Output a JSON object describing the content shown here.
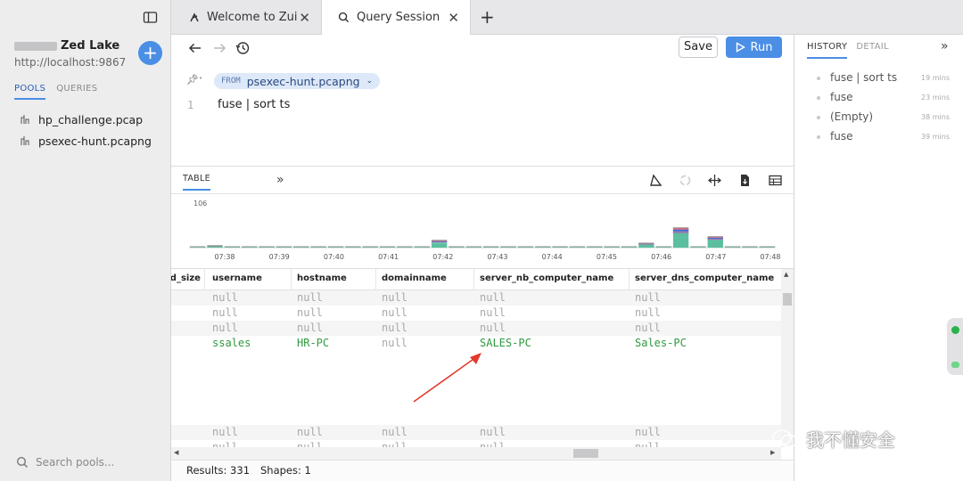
{
  "sidebar": {
    "lake_name": "Zed Lake",
    "lake_url": "http://localhost:9867",
    "add_label": "+",
    "tabs": [
      "POOLS",
      "QUERIES"
    ],
    "pools": [
      "hp_challenge.pcap",
      "psexec-hunt.pcapng"
    ],
    "search_placeholder": "Search pools..."
  },
  "tabs": [
    {
      "label": "Welcome to Zui",
      "icon": "zui-logo-icon"
    },
    {
      "label": "Query Session",
      "icon": "search-icon"
    }
  ],
  "toolbar": {
    "save_label": "Save",
    "run_label": "Run"
  },
  "editor": {
    "from_keyword": "FROM",
    "pool": "psexec-hunt.pcapng",
    "line_number": "1",
    "query": "fuse | sort ts"
  },
  "results": {
    "tab_label": "TABLE",
    "expand": "»",
    "columns": [
      "ed_size",
      "username",
      "hostname",
      "domainname",
      "server_nb_computer_name",
      "server_dns_computer_name"
    ],
    "rows": [
      [
        "",
        "null",
        "null",
        "null",
        "null",
        "null"
      ],
      [
        "",
        "null",
        "null",
        "null",
        "null",
        "null"
      ],
      [
        "",
        "null",
        "null",
        "null",
        "null",
        "null"
      ],
      [
        "",
        "ssales",
        "HR-PC",
        "null",
        "SALES-PC",
        "Sales-PC"
      ],
      [
        "",
        "null",
        "null",
        "null",
        "null",
        "null"
      ],
      [
        "",
        "null",
        "null",
        "null",
        "null",
        "null"
      ]
    ]
  },
  "chart_data": {
    "type": "bar",
    "ymax_label": "106",
    "tick_labels": [
      "07:38",
      "07:39",
      "07:40",
      "07:41",
      "07:42",
      "07:43",
      "07:44",
      "07:45",
      "07:46",
      "07:47",
      "07:48"
    ],
    "values": [
      2,
      6,
      3,
      2,
      2,
      3,
      2,
      2,
      3,
      2,
      2,
      2,
      3,
      2,
      17,
      3,
      2,
      2,
      2,
      2,
      3,
      2,
      2,
      2,
      3,
      2,
      10,
      2,
      48,
      2,
      26,
      2,
      3,
      2
    ],
    "colors": [
      "#8e8e90",
      "#5bbf9f",
      "#9a7ab8",
      "#3a6fd8",
      "#e06a8a"
    ],
    "ylim": [
      0,
      106
    ]
  },
  "footer": {
    "results": "Results: 331",
    "shapes": "Shapes: 1"
  },
  "right_panel": {
    "tabs": [
      "HISTORY",
      "DETAIL"
    ],
    "collapse": "»",
    "history": [
      {
        "query": "fuse | sort ts",
        "time": "19 mins"
      },
      {
        "query": "fuse",
        "time": "23 mins"
      },
      {
        "query": "(Empty)",
        "time": "38 mins"
      },
      {
        "query": "fuse",
        "time": "39 mins"
      }
    ]
  },
  "watermark": "我不懂安全"
}
